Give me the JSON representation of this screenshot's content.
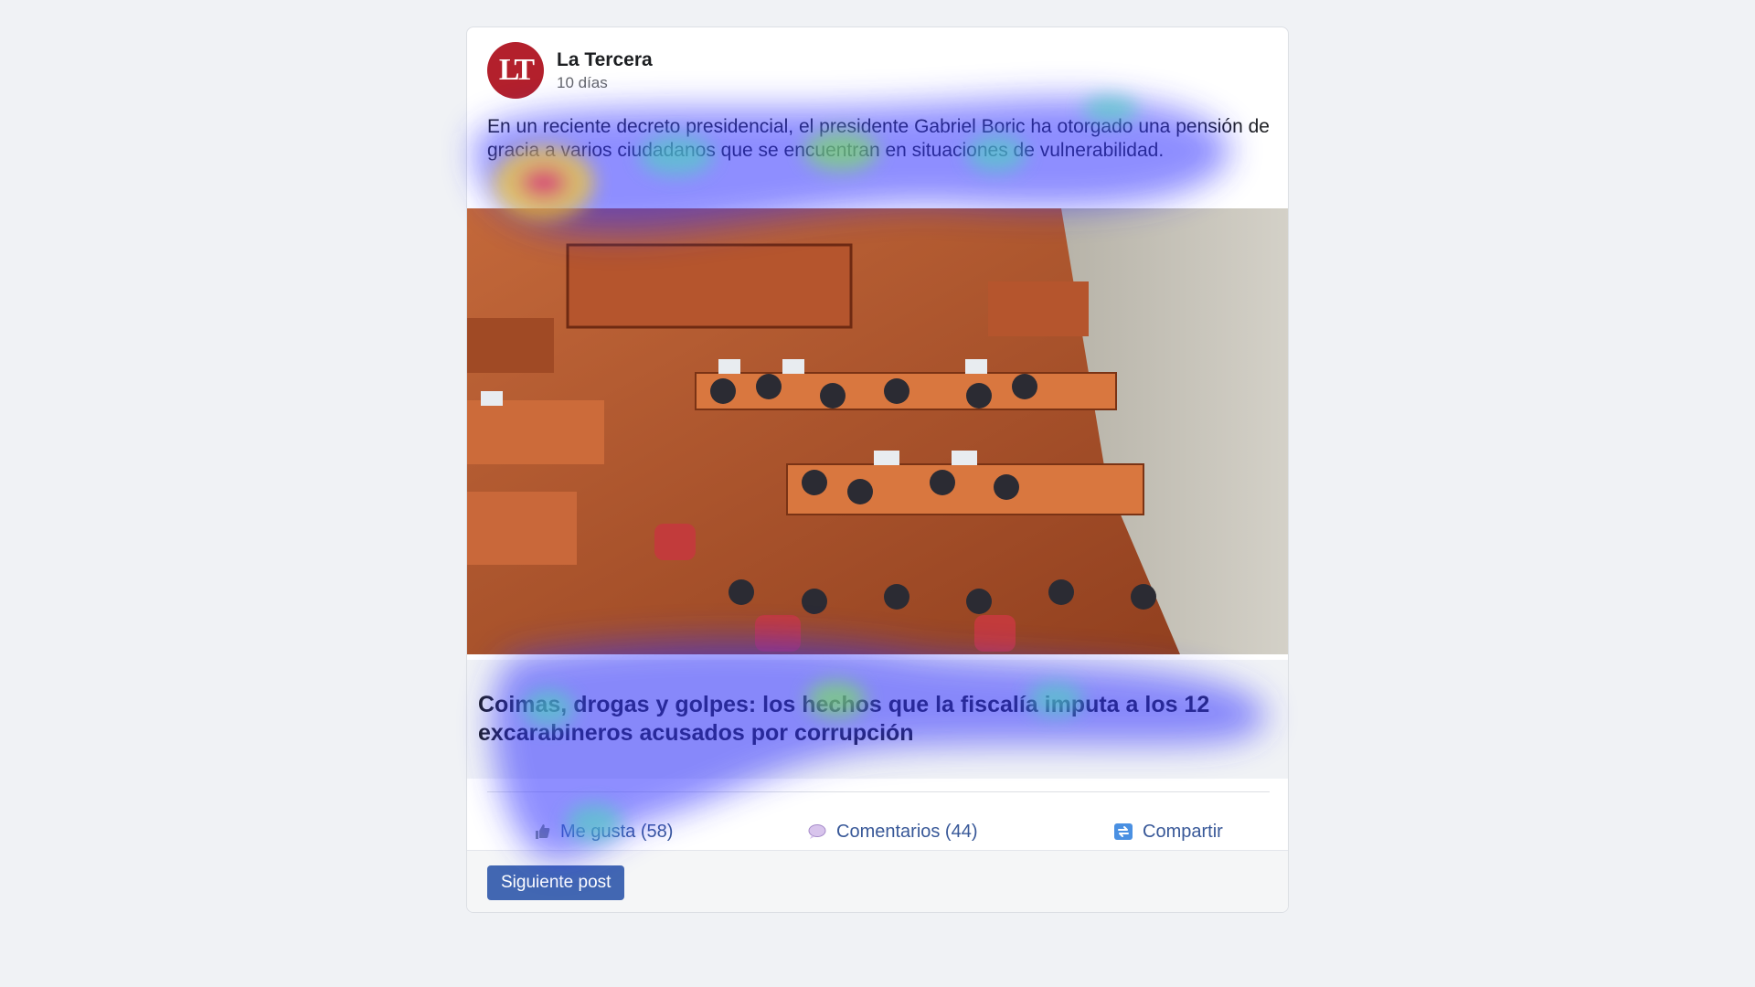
{
  "post": {
    "author": "La Tercera",
    "logo_text": "LT",
    "logo_color": "#b3202c",
    "time": "10 días",
    "text": "En un reciente decreto presidencial, el presidente Gabriel Boric ha otorgado una pensión de gracia a varios ciudadanos que se encuentran en situaciones de vulnerabilidad.",
    "link_title": "Coimas, drogas y golpes: los hechos que la fiscalía imputa a los 12 excarabineros acusados por corrupción"
  },
  "actions": {
    "like": "Me gusta (58)",
    "comments": "Comentarios (44)",
    "share": "Compartir"
  },
  "footer": {
    "next_label": "Siguiente post"
  },
  "colors": {
    "accent": "#4267b2",
    "action_text": "#385898"
  },
  "icons": [
    "thumbs-up-icon",
    "comment-icon",
    "share-icon"
  ]
}
